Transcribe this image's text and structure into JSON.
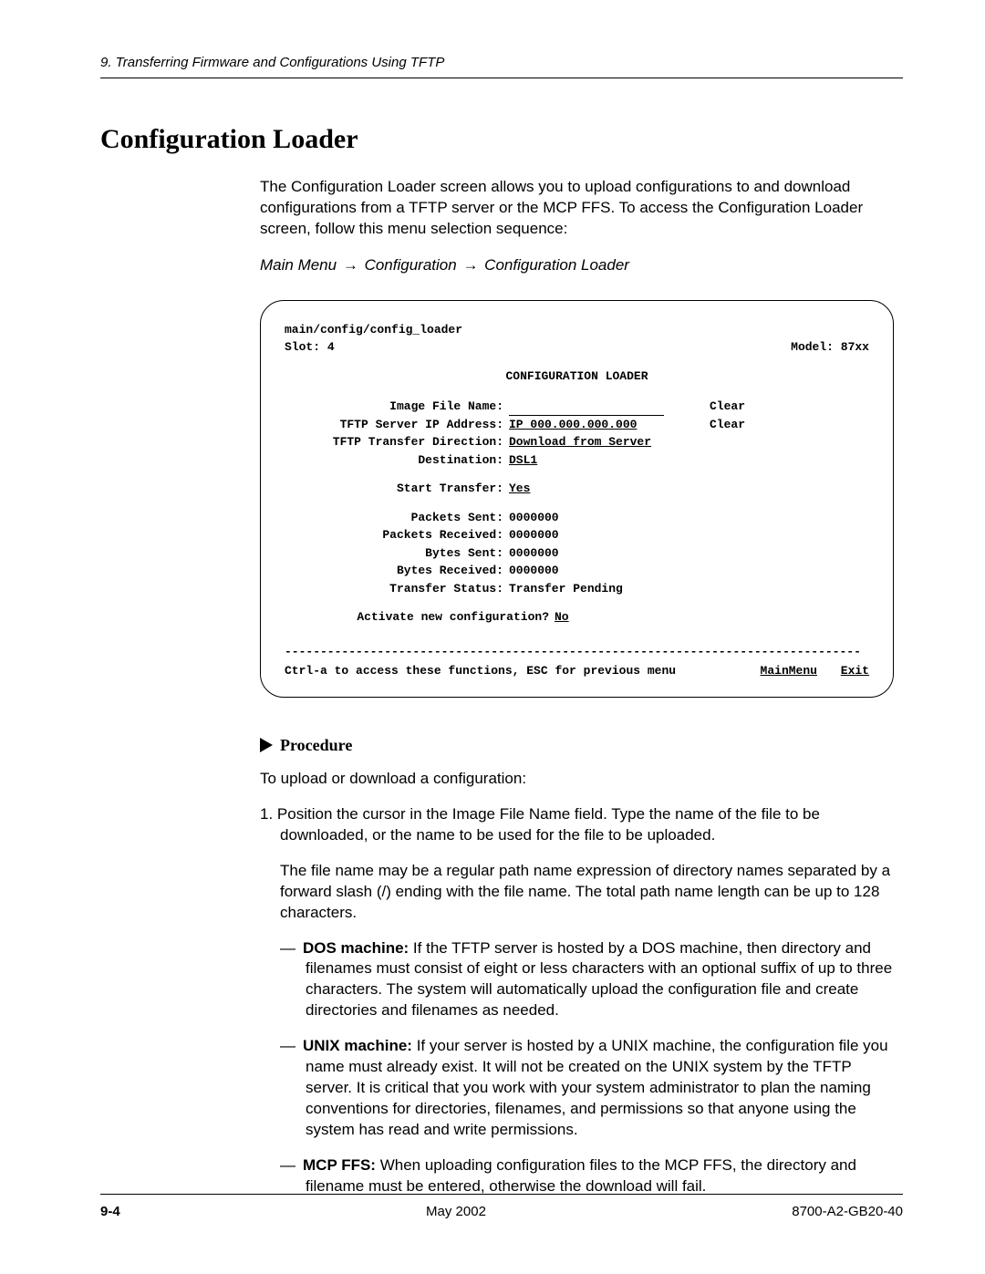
{
  "header": {
    "running": "9. Transferring Firmware and Configurations Using TFTP"
  },
  "title": "Configuration Loader",
  "intro": "The Configuration Loader screen allows you to upload configurations to and download configurations from a TFTP server or the MCP FFS. To access the Configuration Loader screen, follow this menu selection sequence:",
  "menupath": {
    "a": "Main Menu",
    "b": "Configuration",
    "c": "Configuration Loader"
  },
  "terminal": {
    "path": "main/config/config_loader",
    "slot_label": "Slot:",
    "slot_value": "4",
    "model_label": "Model:",
    "model_value": "87xx",
    "screen_title": "CONFIGURATION LOADER",
    "fields": {
      "image_label": "Image File Name:",
      "ip_label": "TFTP Server IP Address:",
      "ip_value": "IP 000.000.000.000",
      "dir_label": "TFTP Transfer Direction:",
      "dir_value": "Download from Server",
      "dest_label": "Destination:",
      "dest_value": "DSL1",
      "start_label": "Start Transfer:",
      "start_value": "Yes",
      "clear1": "Clear",
      "clear2": "Clear"
    },
    "stats": {
      "ps_label": "Packets Sent:",
      "ps_value": "0000000",
      "pr_label": "Packets Received:",
      "pr_value": "0000000",
      "bs_label": "Bytes Sent:",
      "bs_value": "0000000",
      "br_label": "Bytes Received:",
      "br_value": "0000000",
      "ts_label": "Transfer Status:",
      "ts_value": "Transfer Pending"
    },
    "activate_label": "Activate new configuration?",
    "activate_value": "No",
    "help": "Ctrl-a to access these functions, ESC for previous menu",
    "menu1": "MainMenu",
    "menu2": "Exit"
  },
  "procedure": {
    "heading": "Procedure",
    "intro": "To upload or download a configuration:",
    "step1_num": "1.",
    "step1": "Position the cursor in the Image File Name field. Type the name of the file to be downloaded, or the name to be used for the file to be uploaded.",
    "step1b": "The file name may be a regular path name expression of directory names separated by a forward slash (/) ending with the file name. The total path name length can be up to 128 characters.",
    "dos_head": "DOS machine:",
    "dos_body": " If the TFTP server is hosted by a DOS machine, then directory and filenames must consist of eight or less characters with an optional suffix of up to three characters. The system will automatically upload the configuration file and create directories and filenames as needed.",
    "unix_head": "UNIX machine:",
    "unix_body": " If your server is hosted by a UNIX machine, the configuration file you name must already exist. It will not be created on the UNIX system by the TFTP server. It is critical that you work with your system administrator to plan the naming conventions for directories, filenames, and permissions so that anyone using the system has read and write permissions.",
    "mcp_head": "MCP FFS:",
    "mcp_body": " When uploading configuration files to the MCP FFS, the directory and filename must be entered, otherwise the download will fail."
  },
  "footer": {
    "page": "9-4",
    "date": "May 2002",
    "doc": "8700-A2-GB20-40"
  }
}
